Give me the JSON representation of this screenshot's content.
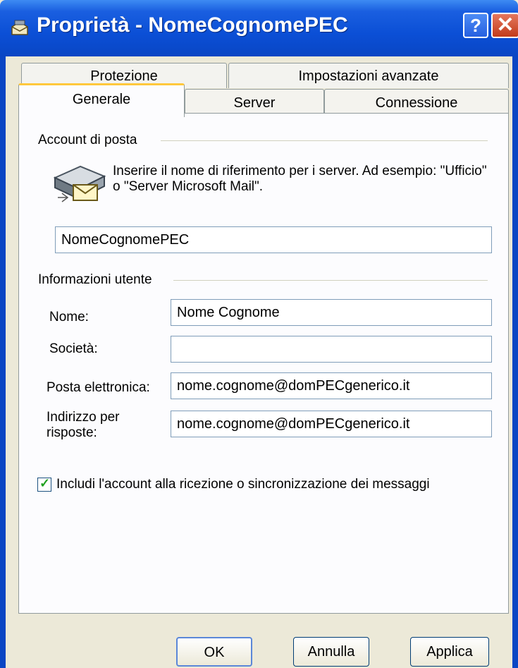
{
  "window": {
    "title": "Proprietà - NomeCognomePEC",
    "help_label": "?",
    "close_label": "✕"
  },
  "tabs": {
    "row1": [
      {
        "label": "Protezione"
      },
      {
        "label": "Impostazioni avanzate"
      }
    ],
    "row2": [
      {
        "label": "Generale",
        "active": true
      },
      {
        "label": "Server"
      },
      {
        "label": "Connessione"
      }
    ]
  },
  "mail_account": {
    "group_label": "Account di posta",
    "description": "Inserire il nome di riferimento per i server. Ad esempio: \"Ufficio\" o \"Server Microsoft Mail\".",
    "account_name": "NomeCognomePEC"
  },
  "user_info": {
    "group_label": "Informazioni utente",
    "name_label": "Nome:",
    "name_value": "Nome Cognome",
    "company_label": "Società:",
    "company_value": "",
    "email_label": "Posta elettronica:",
    "email_value": "nome.cognome@domPECgenerico.it",
    "reply_label": "Indirizzo per risposte:",
    "reply_value": "nome.cognome@domPECgenerico.it"
  },
  "include_account": {
    "checked": true,
    "label": "Includi l'account alla ricezione o sincronizzazione dei messaggi"
  },
  "buttons": {
    "ok": "OK",
    "cancel": "Annulla",
    "apply": "Applica"
  },
  "colors": {
    "titlebar": "#0b4fd6",
    "dialog_bg": "#ece9d8",
    "panel_bg": "#fcfcfe",
    "active_tab_accent": "#ffc83d"
  }
}
